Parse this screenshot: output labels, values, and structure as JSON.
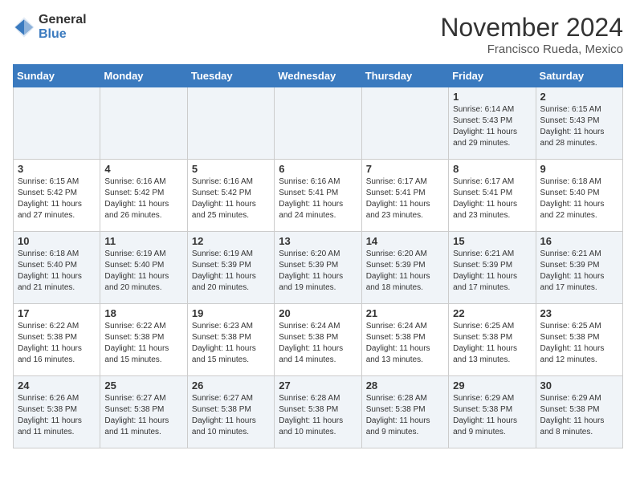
{
  "logo": {
    "general": "General",
    "blue": "Blue"
  },
  "title": "November 2024",
  "subtitle": "Francisco Rueda, Mexico",
  "weekdays": [
    "Sunday",
    "Monday",
    "Tuesday",
    "Wednesday",
    "Thursday",
    "Friday",
    "Saturday"
  ],
  "weeks": [
    [
      {
        "day": "",
        "info": ""
      },
      {
        "day": "",
        "info": ""
      },
      {
        "day": "",
        "info": ""
      },
      {
        "day": "",
        "info": ""
      },
      {
        "day": "",
        "info": ""
      },
      {
        "day": "1",
        "info": "Sunrise: 6:14 AM\nSunset: 5:43 PM\nDaylight: 11 hours and 29 minutes."
      },
      {
        "day": "2",
        "info": "Sunrise: 6:15 AM\nSunset: 5:43 PM\nDaylight: 11 hours and 28 minutes."
      }
    ],
    [
      {
        "day": "3",
        "info": "Sunrise: 6:15 AM\nSunset: 5:42 PM\nDaylight: 11 hours and 27 minutes."
      },
      {
        "day": "4",
        "info": "Sunrise: 6:16 AM\nSunset: 5:42 PM\nDaylight: 11 hours and 26 minutes."
      },
      {
        "day": "5",
        "info": "Sunrise: 6:16 AM\nSunset: 5:42 PM\nDaylight: 11 hours and 25 minutes."
      },
      {
        "day": "6",
        "info": "Sunrise: 6:16 AM\nSunset: 5:41 PM\nDaylight: 11 hours and 24 minutes."
      },
      {
        "day": "7",
        "info": "Sunrise: 6:17 AM\nSunset: 5:41 PM\nDaylight: 11 hours and 23 minutes."
      },
      {
        "day": "8",
        "info": "Sunrise: 6:17 AM\nSunset: 5:41 PM\nDaylight: 11 hours and 23 minutes."
      },
      {
        "day": "9",
        "info": "Sunrise: 6:18 AM\nSunset: 5:40 PM\nDaylight: 11 hours and 22 minutes."
      }
    ],
    [
      {
        "day": "10",
        "info": "Sunrise: 6:18 AM\nSunset: 5:40 PM\nDaylight: 11 hours and 21 minutes."
      },
      {
        "day": "11",
        "info": "Sunrise: 6:19 AM\nSunset: 5:40 PM\nDaylight: 11 hours and 20 minutes."
      },
      {
        "day": "12",
        "info": "Sunrise: 6:19 AM\nSunset: 5:39 PM\nDaylight: 11 hours and 20 minutes."
      },
      {
        "day": "13",
        "info": "Sunrise: 6:20 AM\nSunset: 5:39 PM\nDaylight: 11 hours and 19 minutes."
      },
      {
        "day": "14",
        "info": "Sunrise: 6:20 AM\nSunset: 5:39 PM\nDaylight: 11 hours and 18 minutes."
      },
      {
        "day": "15",
        "info": "Sunrise: 6:21 AM\nSunset: 5:39 PM\nDaylight: 11 hours and 17 minutes."
      },
      {
        "day": "16",
        "info": "Sunrise: 6:21 AM\nSunset: 5:39 PM\nDaylight: 11 hours and 17 minutes."
      }
    ],
    [
      {
        "day": "17",
        "info": "Sunrise: 6:22 AM\nSunset: 5:38 PM\nDaylight: 11 hours and 16 minutes."
      },
      {
        "day": "18",
        "info": "Sunrise: 6:22 AM\nSunset: 5:38 PM\nDaylight: 11 hours and 15 minutes."
      },
      {
        "day": "19",
        "info": "Sunrise: 6:23 AM\nSunset: 5:38 PM\nDaylight: 11 hours and 15 minutes."
      },
      {
        "day": "20",
        "info": "Sunrise: 6:24 AM\nSunset: 5:38 PM\nDaylight: 11 hours and 14 minutes."
      },
      {
        "day": "21",
        "info": "Sunrise: 6:24 AM\nSunset: 5:38 PM\nDaylight: 11 hours and 13 minutes."
      },
      {
        "day": "22",
        "info": "Sunrise: 6:25 AM\nSunset: 5:38 PM\nDaylight: 11 hours and 13 minutes."
      },
      {
        "day": "23",
        "info": "Sunrise: 6:25 AM\nSunset: 5:38 PM\nDaylight: 11 hours and 12 minutes."
      }
    ],
    [
      {
        "day": "24",
        "info": "Sunrise: 6:26 AM\nSunset: 5:38 PM\nDaylight: 11 hours and 11 minutes."
      },
      {
        "day": "25",
        "info": "Sunrise: 6:27 AM\nSunset: 5:38 PM\nDaylight: 11 hours and 11 minutes."
      },
      {
        "day": "26",
        "info": "Sunrise: 6:27 AM\nSunset: 5:38 PM\nDaylight: 11 hours and 10 minutes."
      },
      {
        "day": "27",
        "info": "Sunrise: 6:28 AM\nSunset: 5:38 PM\nDaylight: 11 hours and 10 minutes."
      },
      {
        "day": "28",
        "info": "Sunrise: 6:28 AM\nSunset: 5:38 PM\nDaylight: 11 hours and 9 minutes."
      },
      {
        "day": "29",
        "info": "Sunrise: 6:29 AM\nSunset: 5:38 PM\nDaylight: 11 hours and 9 minutes."
      },
      {
        "day": "30",
        "info": "Sunrise: 6:29 AM\nSunset: 5:38 PM\nDaylight: 11 hours and 8 minutes."
      }
    ]
  ]
}
